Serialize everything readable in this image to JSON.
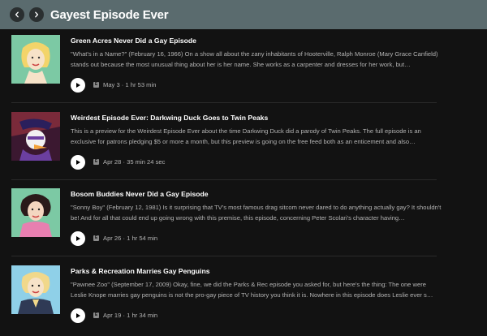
{
  "header": {
    "title": "Gayest Episode Ever",
    "back_icon": "chevron-left-icon",
    "forward_icon": "chevron-right-icon",
    "background": "#5a6b6e"
  },
  "episodes": [
    {
      "title": "Green Acres Never Did a Gay Episode",
      "description": "\"What's in a Name?\" (February 16, 1966) On a show all about the zany inhabitants of Hooterville, Ralph Monroe (Mary Grace Canfield) stands out because the most unusual thing about her is her name. She works as a carpenter and dresses for her work, but…",
      "badge": "E",
      "meta": "May 3 · 1 hr 53 min",
      "cover_bg": "#7cc9a4"
    },
    {
      "title": "Weirdest Episode Ever: Darkwing Duck Goes to Twin Peaks",
      "description": "This is a preview for the Weirdest Episode Ever about the time Darkwing Duck did a parody of Twin Peaks. The full episode is an exclusive for patrons pledging $5 or more a month, but this preview is going on the free feed both as an enticement and also…",
      "badge": "E",
      "meta": "Apr 28 · 35 min 24 sec",
      "cover_bg": "#6a2a3a"
    },
    {
      "title": "Bosom Buddies Never Did a Gay Episode",
      "description": "\"Sonny Boy\" (February 12, 1981) Is it surprising that TV's most famous drag sitcom never dared to do anything actually gay? It shouldn't be! And for all that could end up going wrong with this premise, this episode, concerning Peter Scolari's character having…",
      "badge": "E",
      "meta": "Apr 26 · 1 hr 54 min",
      "cover_bg": "#7cc9a4"
    },
    {
      "title": "Parks & Recreation Marries Gay Penguins",
      "description": "\"Pawnee Zoo\" (September 17, 2009) Okay, fine, we did the Parks & Rec episode you asked for, but here's the thing: The one were Leslie Knope marries gay penguins is not the pro-gay piece of TV history you think it is. Nowhere in this episode does Leslie ever s…",
      "badge": "E",
      "meta": "Apr 19 · 1 hr 34 min",
      "cover_bg": "#8fd0e8"
    }
  ]
}
